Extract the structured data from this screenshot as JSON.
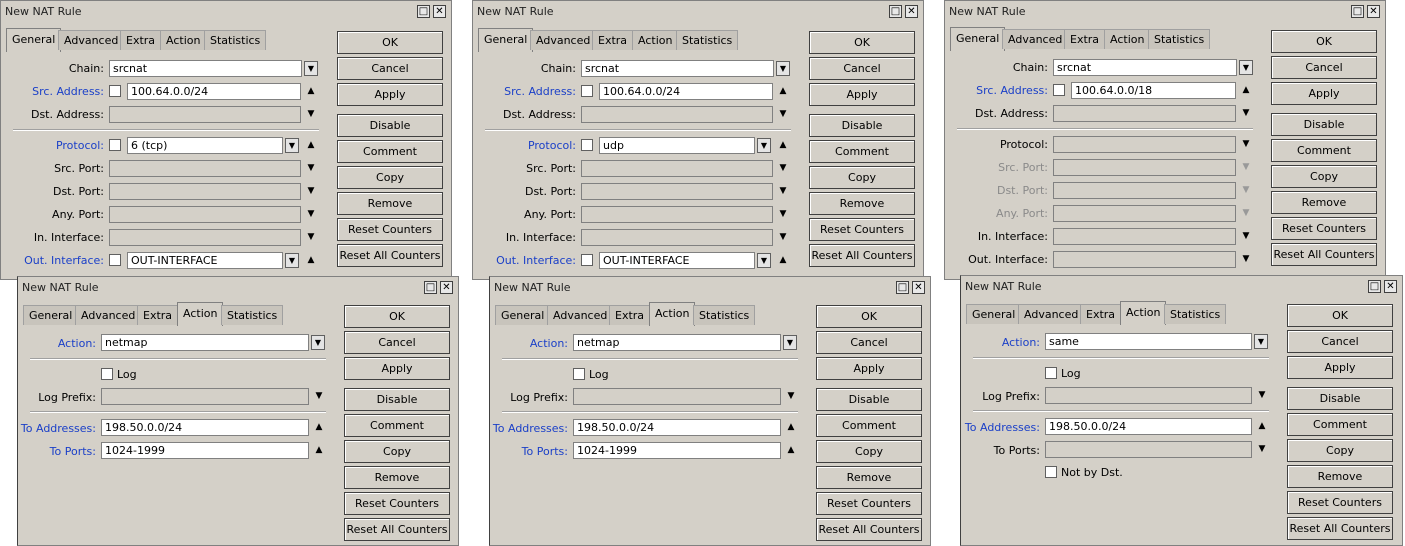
{
  "window_title": "New NAT Rule",
  "title_buttons": {
    "maximize": "□",
    "close": "✕"
  },
  "tabs": [
    "General",
    "Advanced",
    "Extra",
    "Action",
    "Statistics"
  ],
  "buttons": [
    "OK",
    "Cancel",
    "Apply",
    "Disable",
    "Comment",
    "Copy",
    "Remove",
    "Reset Counters",
    "Reset All Counters"
  ],
  "labels": {
    "chain": "Chain:",
    "src_address": "Src. Address:",
    "dst_address": "Dst. Address:",
    "protocol": "Protocol:",
    "src_port": "Src. Port:",
    "dst_port": "Dst. Port:",
    "any_port": "Any. Port:",
    "in_interface": "In. Interface:",
    "out_interface": "Out. Interface:",
    "action": "Action:",
    "log": "Log",
    "log_prefix": "Log Prefix:",
    "to_addresses": "To Addresses:",
    "to_ports": "To Ports:",
    "not_by_dst": "Not by Dst."
  },
  "general_windows": [
    {
      "chain": "srcnat",
      "src_address": "100.64.0.0/24",
      "protocol": "6 (tcp)",
      "out_interface": "OUT-INTERFACE"
    },
    {
      "chain": "srcnat",
      "src_address": "100.64.0.0/24",
      "protocol": "udp",
      "out_interface": "OUT-INTERFACE"
    },
    {
      "chain": "srcnat",
      "src_address": "100.64.0.0/18",
      "protocol": "",
      "out_interface": ""
    }
  ],
  "action_windows": [
    {
      "action": "netmap",
      "to_addresses": "198.50.0.0/24",
      "to_ports": "1024-1999"
    },
    {
      "action": "netmap",
      "to_addresses": "198.50.0.0/24",
      "to_ports": "1024-1999"
    },
    {
      "action": "same",
      "to_addresses": "198.50.0.0/24",
      "to_ports": ""
    }
  ]
}
